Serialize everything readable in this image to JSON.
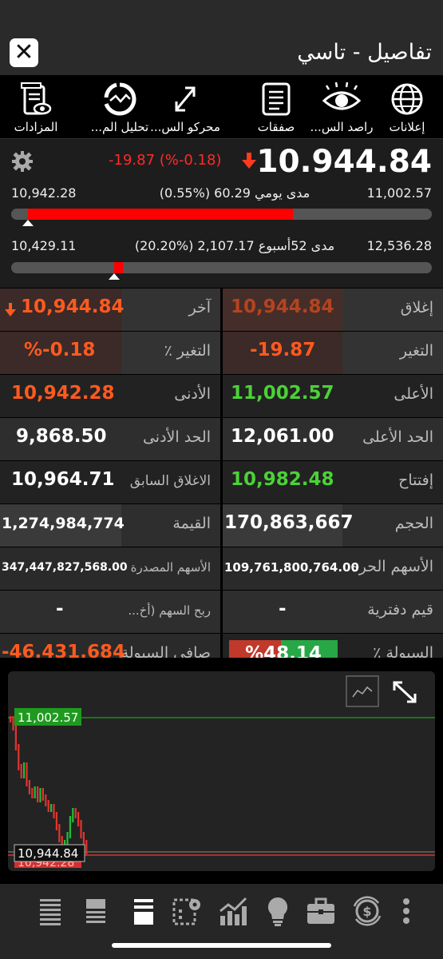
{
  "header": {
    "title": "تفاصيل - تاسي",
    "close_icon": "close-icon"
  },
  "toolbar": [
    {
      "name": "announcements",
      "label": "إعلانات",
      "icon": "globe-icon"
    },
    {
      "name": "market-watcher",
      "label": "راصد الس...",
      "icon": "eye-icon"
    },
    {
      "name": "trades",
      "label": "صفقات",
      "icon": "list-icon"
    },
    {
      "name": "market-movers",
      "label": "محركو الس...",
      "icon": "arrows-icon"
    },
    {
      "name": "analysis",
      "label": "تحليل الم...",
      "icon": "analysis-icon"
    },
    {
      "name": "auctions",
      "label": "المزادات",
      "icon": "auction-icon"
    }
  ],
  "summary": {
    "last": "10.944.84",
    "change_text": "-19.87 (%-0.18)",
    "daily_range": {
      "low": "10,942.28",
      "high": "11,002.57",
      "label": "مدى يومي 60.29 (%0.55)",
      "fill_start": 0.04,
      "fill_end": 0.67,
      "marker": 0.04
    },
    "week52_range": {
      "low": "10,429.11",
      "high": "12,536.28",
      "label": "مدى 52أسبوع 2,107.17 (%20.20)",
      "fill_start": 0.245,
      "fill_end": 0.265,
      "marker": 0.245
    }
  },
  "details": {
    "close": {
      "label": "إغلاق",
      "value": "10,944.84"
    },
    "last": {
      "label": "آخر",
      "value": "10,944.84"
    },
    "change": {
      "label": "التغير",
      "value": "-19.87"
    },
    "change_pct": {
      "label": "التغير ٪",
      "value": "%-0.18"
    },
    "high": {
      "label": "الأعلى",
      "value": "11,002.57"
    },
    "low": {
      "label": "الأدنى",
      "value": "10,942.28"
    },
    "upper_limit": {
      "label": "الحد الأعلى",
      "value": "12,061.00"
    },
    "lower_limit": {
      "label": "الحد الأدنى",
      "value": "9,868.50"
    },
    "open": {
      "label": "إفتتاح",
      "value": "10,982.48"
    },
    "prev_close": {
      "label": "الاغلاق السابق",
      "value": "10,964.71"
    },
    "volume": {
      "label": "الحجم",
      "value": "170,863,667"
    },
    "value": {
      "label": "القيمة",
      "value": "1,274,984,774"
    },
    "free_float": {
      "label": "الأسهم الحرة",
      "value": "109,761,800,764.00"
    },
    "issued_shares": {
      "label": "الأسهم المصدرة",
      "value": "347,447,827,568.00"
    },
    "book_value": {
      "label": "قيم دفترية",
      "value": "-"
    },
    "eps": {
      "label": "ربح السهم (أخ...",
      "value": "-"
    },
    "liquidity_pct": {
      "label": "السيولة ٪",
      "value": "%48.14",
      "green_share": 0.52
    },
    "net_liquidity": {
      "label": "صافي السيولة",
      "value": "-46,431,684"
    }
  },
  "chart": {
    "high_label": "11,002.57",
    "last_label": "10,944.84",
    "hidden_label": "10,942.28",
    "colors": {
      "up": "#1fbf3a",
      "down": "#e3342f",
      "high_line": "#1a8f1a",
      "last_line": "#dd3333"
    }
  },
  "bottom_nav": [
    "list-icon",
    "list-icon",
    "list-icon",
    "settings-board-icon",
    "chart-up-icon",
    "lightbulb-icon",
    "briefcase-icon",
    "dollar-icon",
    "more-icon"
  ]
}
